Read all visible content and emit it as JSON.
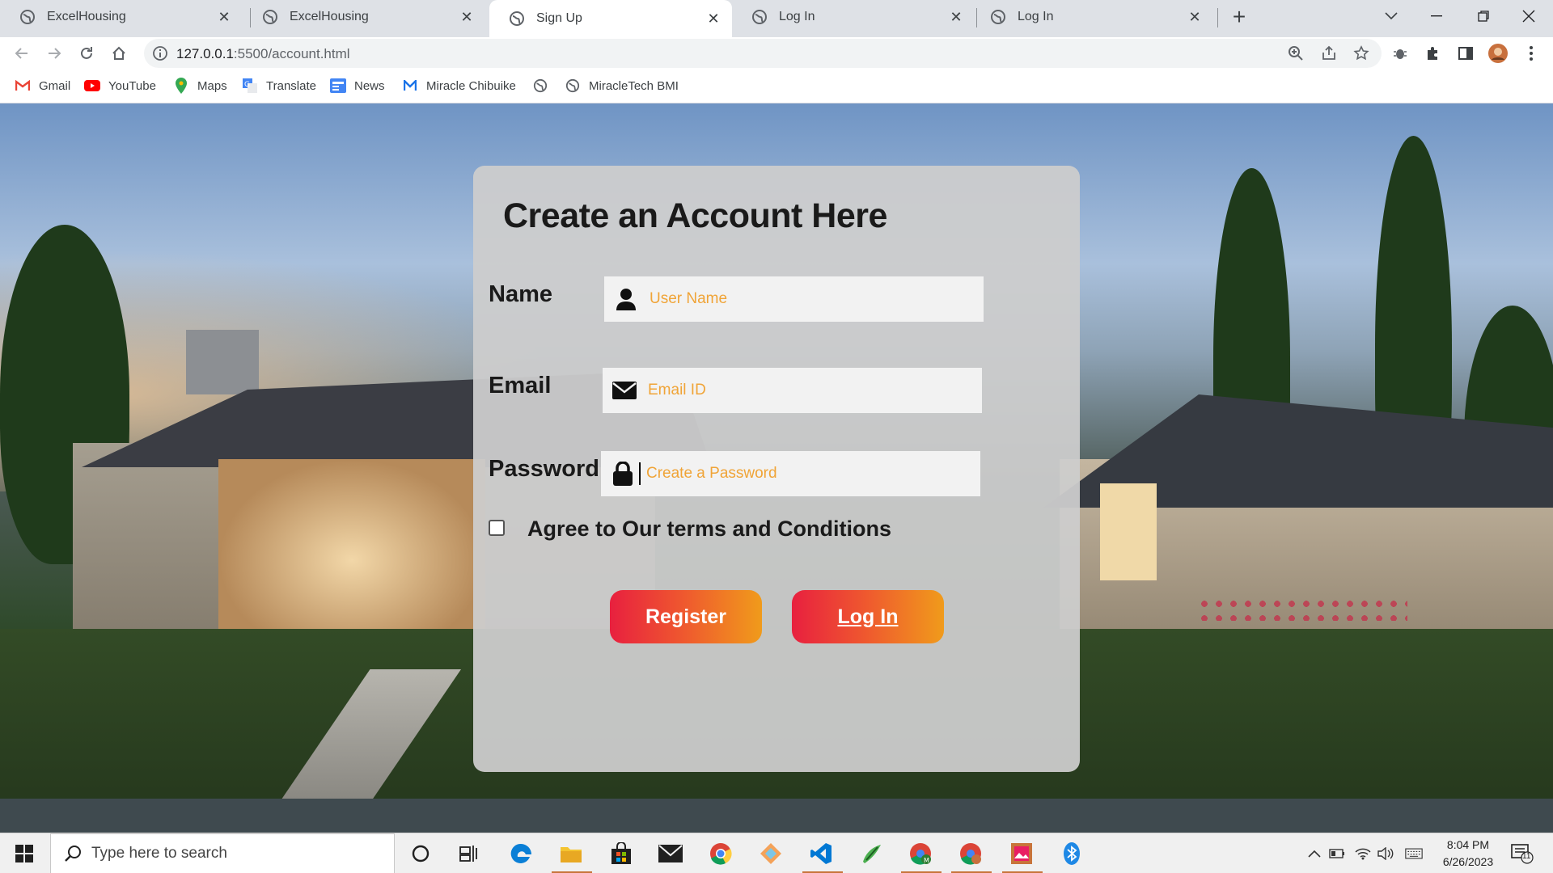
{
  "tabs": [
    {
      "title": "ExcelHousing"
    },
    {
      "title": "ExcelHousing"
    },
    {
      "title": "Sign Up"
    },
    {
      "title": "Log In"
    },
    {
      "title": "Log In"
    }
  ],
  "omnibox": {
    "url_host": "127.0.0.1",
    "url_path": ":5500/account.html"
  },
  "bookmarks": [
    {
      "label": "Gmail",
      "icon": "gmail-icon"
    },
    {
      "label": "YouTube",
      "icon": "youtube-icon"
    },
    {
      "label": "Maps",
      "icon": "maps-icon"
    },
    {
      "label": "Translate",
      "icon": "translate-icon"
    },
    {
      "label": "News",
      "icon": "news-icon"
    },
    {
      "label": "Miracle Chibuike",
      "icon": "m-icon"
    },
    {
      "label": "",
      "icon": "globe-icon"
    },
    {
      "label": "MiracleTech BMI",
      "icon": "globe-icon"
    }
  ],
  "form": {
    "title": "Create an Account Here",
    "name_label": "Name",
    "name_placeholder": "User Name",
    "email_label": "Email",
    "email_placeholder": "Email ID",
    "password_label": "Password",
    "password_placeholder": "Create a Password",
    "agree_label": "Agree to Our terms and Conditions",
    "register_label": "Register",
    "login_label": "Log In"
  },
  "taskbar": {
    "search_placeholder": "Type here to search",
    "time": "8:04 PM",
    "date": "6/26/2023",
    "notification_count": "11"
  },
  "colors": {
    "placeholder": "#f0a437",
    "button_gradient_start": "#e8203f",
    "button_gradient_end": "#f09b1b"
  }
}
